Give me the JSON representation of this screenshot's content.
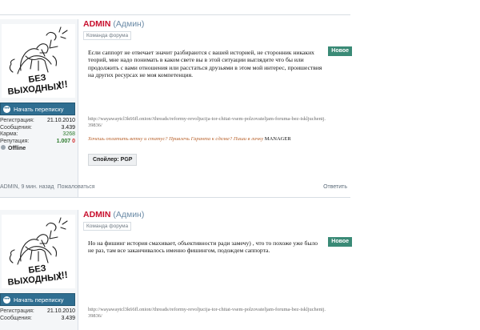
{
  "posts": [
    {
      "username": "ADMIN",
      "role": "(Админ)",
      "user_title": "Команда форума",
      "new_badge": "Новое",
      "start_conversation": "Начать переписку",
      "stats": [
        {
          "label": "Регистрация:",
          "value": "21.10.2010"
        },
        {
          "label": "Сообщения:",
          "value": "3.439"
        },
        {
          "label": "Карма:",
          "value": "3268"
        }
      ],
      "reputation_label": "Репутация:",
      "reputation_pos": "1.007",
      "reputation_neg": "0",
      "status": "Offline",
      "body": "Если саппорт не отвечает значит разбираются с вашей историей, не сторонник никаких теорий, мне надо понимать в каком свете вы в этой ситуации выглядите что бы или продолжить с вами отношения или расстаться друзьями в этом мой интерес, проишествия на других ресурсах не моя компетенция.",
      "link": "http://wayawaytcl3k66fl.onion//threads/reformy-revoljucija-tor-chitat-vsem-polzovateljam-foruma-bez-iskljuchenij.39836/",
      "signature": "Хочешь оплатить ветку и статус? Привлечь Гаранта к сделке? Пиши в личку",
      "signature_name": "MANAGER",
      "spoiler": "Спойлер: PGP",
      "meta": "ADMIN, 9 мин. назад",
      "complain": "Пожаловаться",
      "reply": "Ответить"
    },
    {
      "username": "ADMIN",
      "role": "(Админ)",
      "user_title": "Команда форума",
      "new_badge": "Новое",
      "start_conversation": "Начать переписку",
      "stats": [
        {
          "label": "Регистрация:",
          "value": "21.10.2010"
        },
        {
          "label": "Сообщения:",
          "value": "3.439"
        }
      ],
      "body": "Но на фишинг история смахивает, объективности ради замечу) , что то похоже уже было не раз, там все заканчивалось именно фишингом, подождем саппорта.",
      "link": "http://wayawaytcl3k66fl.onion//threads/reformy-revoljucija-tor-chitat-vsem-polzovateljam-foruma-bez-iskljuchenij.39836/"
    }
  ],
  "avatar": {
    "caption_line1": "БЕЗ",
    "caption_line2": "ВЫХОДНЫХ",
    "caption_mark": "!!!"
  },
  "colors": {
    "username": "#c8102e",
    "badge": "#3a8a76",
    "button": "#2f6e91",
    "signature": "#b8622c"
  }
}
